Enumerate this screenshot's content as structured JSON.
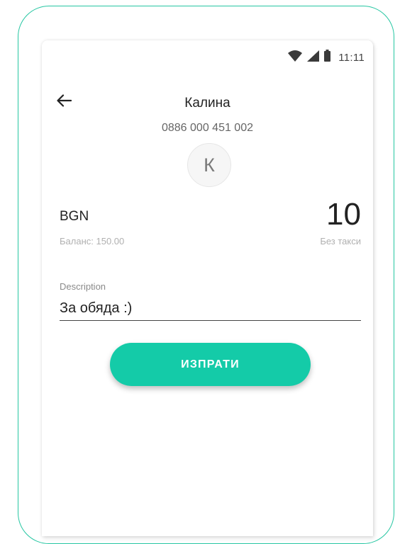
{
  "status_bar": {
    "time": "11:11",
    "icons": [
      "wifi-icon",
      "cell-signal-icon",
      "battery-icon"
    ]
  },
  "header": {
    "back_icon": "arrow-left-icon",
    "contact_name": "Калина",
    "contact_phone": "0886 000 451 002",
    "avatar_initial": "К"
  },
  "transfer": {
    "currency": "BGN",
    "balance": "Баланс: 150.00",
    "amount": "10",
    "fee_note": "Без такси"
  },
  "description": {
    "label": "Description",
    "value": "За обяда :)"
  },
  "actions": {
    "send_label": "ИЗПРАТИ"
  },
  "colors": {
    "accent": "#14cba8",
    "device_outline": "#26c6a2"
  }
}
